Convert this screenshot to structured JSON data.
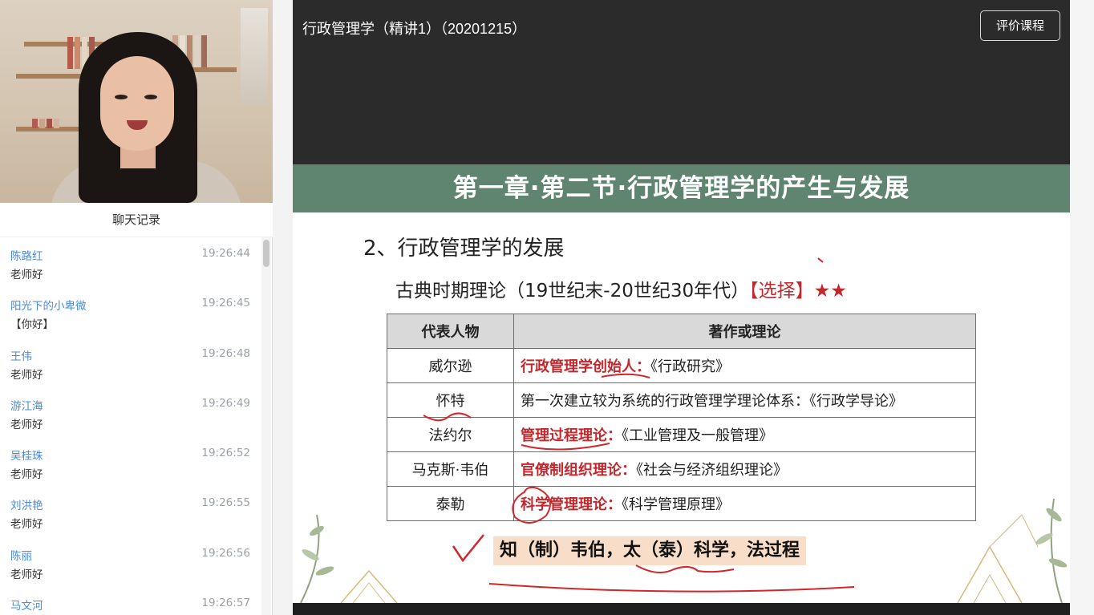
{
  "chat": {
    "title": "聊天记录",
    "messages": [
      {
        "name": "陈路红",
        "time": "19:26:44",
        "text": "老师好"
      },
      {
        "name": "阳光下的小卑微",
        "time": "19:26:45",
        "text": "【你好】"
      },
      {
        "name": "王伟",
        "time": "19:26:48",
        "text": "老师好"
      },
      {
        "name": "游江海",
        "time": "19:26:49",
        "text": "老师好"
      },
      {
        "name": "吴桂珠",
        "time": "19:26:52",
        "text": "老师好"
      },
      {
        "name": "刘洪艳",
        "time": "19:26:55",
        "text": "老师好"
      },
      {
        "name": "陈丽",
        "time": "19:26:56",
        "text": "老师好"
      },
      {
        "name": "马文河",
        "time": "19:26:57",
        "text": ""
      }
    ]
  },
  "course": {
    "title": "行政管理学（精讲1）（20201215）",
    "rate_button": "评价课程"
  },
  "slide": {
    "header": "第一章·第二节·行政管理学的产生与发展",
    "heading": "2、行政管理学的发展",
    "subheading": "古典时期理论（19世纪末-20世纪30年代）",
    "tag": "【选择】",
    "stars": "★★",
    "table": {
      "headers": [
        "代表人物",
        "著作或理论"
      ],
      "rows": [
        {
          "person": "威尔逊",
          "highlight": "行政管理学创始人：",
          "work": "《行政研究》"
        },
        {
          "person": "怀特",
          "highlight": "",
          "work": "第一次建立较为系统的行政管理学理论体系：《行政学导论》"
        },
        {
          "person": "法约尔",
          "highlight": "管理过程理论：",
          "work": "《工业管理及一般管理》"
        },
        {
          "person": "马克斯·韦伯",
          "highlight": "官僚制组织理论：",
          "work": "《社会与经济组织理论》"
        },
        {
          "person": "泰勒",
          "highlight": "科学管理理论：",
          "work": "《科学管理原理》"
        }
      ]
    },
    "mnemonic": "知（制）韦伯，太（泰）科学，法过程"
  },
  "colors": {
    "header_bg": "#5f8470",
    "highlight_red": "#c0282d",
    "stage_bg": "#2b2b2b",
    "chat_name": "#4a8ad6",
    "mnemonic_bg": "#f8ddc8"
  }
}
